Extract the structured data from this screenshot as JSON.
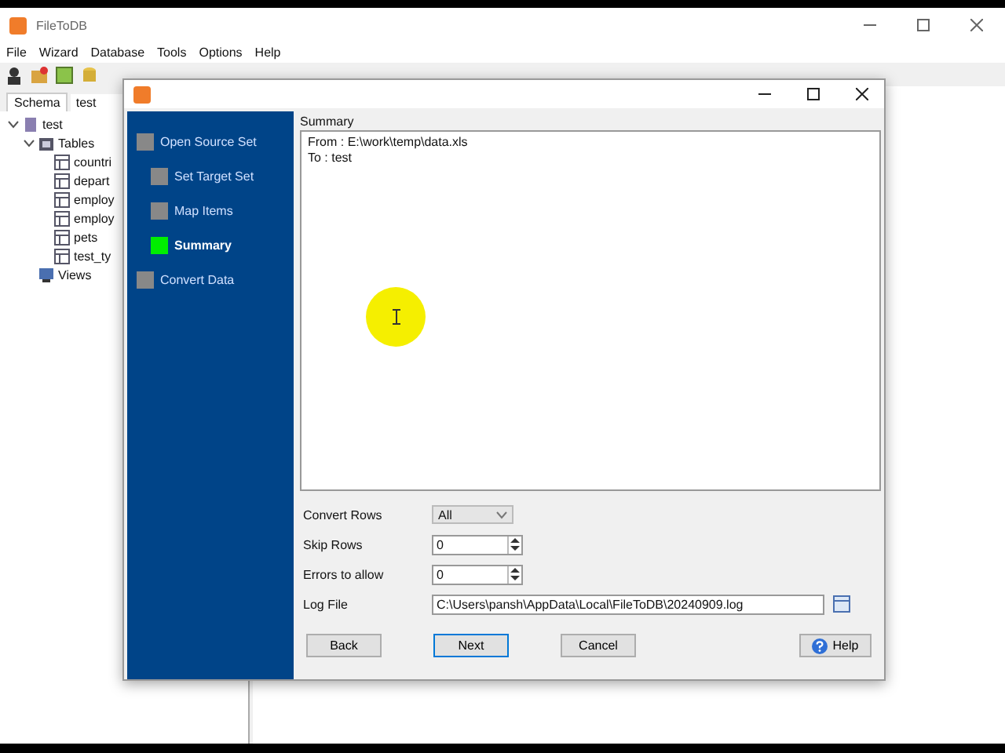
{
  "app": {
    "title": "FileToDB",
    "menu": [
      "File",
      "Wizard",
      "Database",
      "Tools",
      "Options",
      "Help"
    ],
    "schema_tab": "Schema",
    "schema_value": "test",
    "tree": [
      {
        "label": "test",
        "kind": "db",
        "expanded": true,
        "children": [
          {
            "label": "Tables",
            "kind": "folder",
            "expanded": true,
            "children": [
              {
                "label": "countri",
                "kind": "table"
              },
              {
                "label": "depart",
                "kind": "table"
              },
              {
                "label": "employ",
                "kind": "table"
              },
              {
                "label": "employ",
                "kind": "table"
              },
              {
                "label": "pets",
                "kind": "table"
              },
              {
                "label": "test_ty",
                "kind": "table"
              }
            ]
          },
          {
            "label": "Views",
            "kind": "views"
          }
        ]
      }
    ]
  },
  "dialog": {
    "steps": [
      {
        "label": "Open Source Set",
        "selected": false,
        "children": [
          {
            "label": "Set Target Set",
            "selected": false
          },
          {
            "label": "Map Items",
            "selected": false
          },
          {
            "label": "Summary",
            "selected": true
          }
        ]
      },
      {
        "label": "Convert Data",
        "selected": false
      }
    ],
    "summary_label": "Summary",
    "summary_lines": [
      "From : E:\\work\\temp\\data.xls",
      "To : test"
    ],
    "fields": [
      {
        "kind": "select",
        "label": "Convert Rows",
        "value": "All"
      },
      {
        "kind": "spin",
        "label": "Skip Rows",
        "value": "0"
      },
      {
        "kind": "spin",
        "label": "Errors to allow",
        "value": "0"
      },
      {
        "kind": "file",
        "label": "Log File",
        "value": "C:\\Users\\pansh\\AppData\\Local\\FileToDB\\20240909.log"
      }
    ],
    "buttons": [
      {
        "label": "Back",
        "kind": "plain"
      },
      {
        "label": "Next",
        "kind": "default"
      },
      {
        "label": "Cancel",
        "kind": "plain"
      },
      {
        "label": "Help",
        "kind": "help"
      }
    ]
  }
}
